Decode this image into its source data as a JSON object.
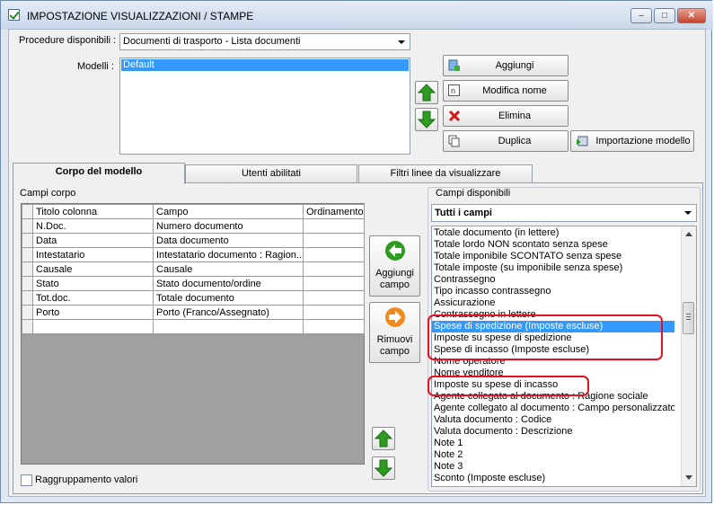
{
  "window": {
    "title": "IMPOSTAZIONE VISUALIZZAZIONI / STAMPE",
    "minimize_symbol": "–",
    "maximize_symbol": "□",
    "close_symbol": "✕"
  },
  "procedures": {
    "label": "Procedure disponibili :",
    "selected": "Documenti di trasporto - Lista documenti"
  },
  "models": {
    "label": "Modelli :",
    "items": [
      "Default"
    ]
  },
  "buttons": {
    "add": "Aggiungi",
    "rename": "Modifica nome",
    "delete": "Elimina",
    "duplicate": "Duplica",
    "import": "Importazione modello"
  },
  "tabs": [
    "Corpo del modello",
    "Utenti abilitati",
    "Filtri linee da visualizzare"
  ],
  "body_fields": {
    "label": "Campi corpo",
    "columns": [
      "Titolo colonna",
      "Campo",
      "Ordinamento"
    ],
    "rows": [
      [
        "N.Doc.",
        "Numero documento",
        ""
      ],
      [
        "Data",
        "Data documento",
        ""
      ],
      [
        "Intestatario",
        "Intestatario documento : Ragion...",
        ""
      ],
      [
        "Causale",
        "Causale",
        ""
      ],
      [
        "Stato",
        "Stato documento/ordine",
        ""
      ],
      [
        "Tot.doc.",
        "Totale documento",
        ""
      ],
      [
        "Porto",
        "Porto (Franco/Assegnato)",
        ""
      ]
    ]
  },
  "field_actions": {
    "add": "Aggiungi campo",
    "remove": "Rimuovi campo"
  },
  "available_fields": {
    "label": "Campi disponibili",
    "filter": "Tutti i campi",
    "items": [
      "Totale documento (in lettere)",
      "Totale lordo NON scontato senza spese",
      "Totale imponibile SCONTATO senza spese",
      "Totale imposte (su imponibile senza spese)",
      "Contrassegno",
      "Tipo incasso contrassegno",
      "Assicurazione",
      "Contrassegno in lettere",
      "Spese di spedizione (Imposte escluse)",
      "Imposte su spese di spedizione",
      "Spese di incasso (Imposte escluse)",
      "Nome operatore",
      "Nome venditore",
      "Imposte su spese di incasso",
      "Agente collegato al documento : Ragione sociale",
      "Agente collegato al documento : Campo personalizzato (su",
      "Valuta documento : Codice",
      "Valuta documento : Descrizione",
      "Note 1",
      "Note 2",
      "Note 3",
      "Sconto (Imposte escluse)"
    ],
    "selected_index": 8
  },
  "grouping": {
    "label": "Raggruppamento valori"
  },
  "colors": {
    "selection": "#3399ff",
    "highlight_box": "#e8101e",
    "arrow_green": "#2e9b21",
    "arrow_orange": "#f08a1c"
  }
}
